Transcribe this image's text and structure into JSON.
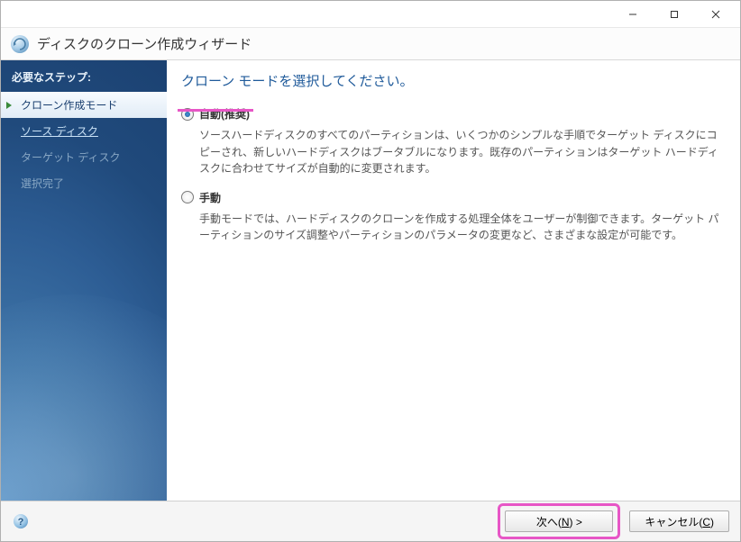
{
  "window": {
    "title": "ディスクのクローン作成ウィザード"
  },
  "sidebar": {
    "header": "必要なステップ:",
    "steps": [
      {
        "label": "クローン作成モード",
        "state": "active"
      },
      {
        "label": "ソース ディスク",
        "state": "link"
      },
      {
        "label": "ターゲット ディスク",
        "state": "disabled"
      },
      {
        "label": "選択完了",
        "state": "disabled"
      }
    ]
  },
  "main": {
    "title": "クローン モードを選択してください。",
    "options": [
      {
        "id": "auto",
        "label": "自動(推奨)",
        "checked": true,
        "desc": "ソースハードディスクのすべてのパーティションは、いくつかのシンプルな手順でターゲット ディスクにコピーされ、新しいハードディスクはブータブルになります。既存のパーティションはターゲット ハードディスクに合わせてサイズが自動的に変更されます。"
      },
      {
        "id": "manual",
        "label": "手動",
        "checked": false,
        "desc": "手動モードでは、ハードディスクのクローンを作成する処理全体をユーザーが制御できます。ターゲット パーティションのサイズ調整やパーティションのパラメータの変更など、さまざまな設定が可能です。"
      }
    ]
  },
  "footer": {
    "next_prefix": "次へ(",
    "next_key": "N",
    "next_suffix": ") >",
    "cancel_prefix": "キャンセル(",
    "cancel_key": "C",
    "cancel_suffix": ")"
  },
  "annotation_color": "#e756c6"
}
